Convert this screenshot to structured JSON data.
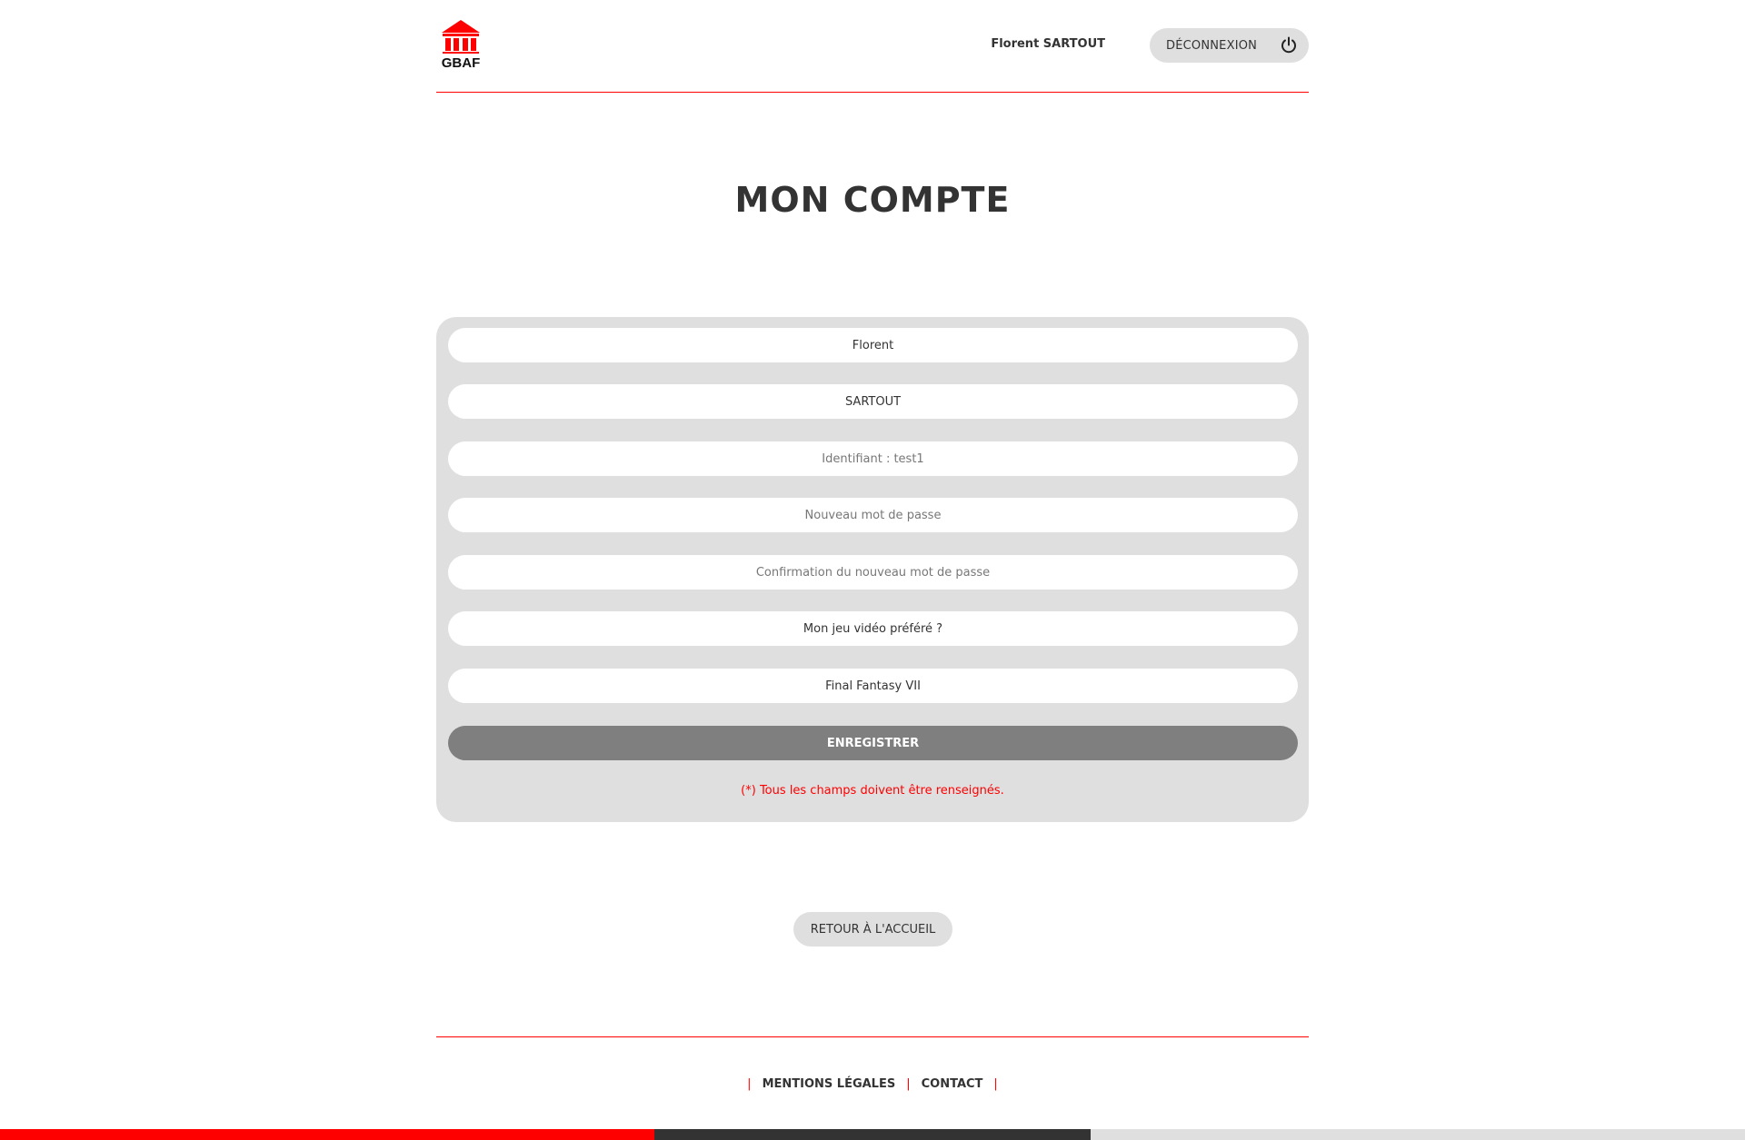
{
  "header": {
    "logo_text": "GBAF",
    "user_name": "Florent SARTOUT",
    "logout_label": "DÉCONNEXION"
  },
  "page": {
    "title": "MON COMPTE"
  },
  "form": {
    "first_name": {
      "value": "Florent"
    },
    "last_name": {
      "value": "SARTOUT"
    },
    "username": {
      "placeholder": "Identifiant : test1"
    },
    "new_password": {
      "placeholder": "Nouveau mot de passe"
    },
    "confirm_password": {
      "placeholder": "Confirmation du nouveau mot de passe"
    },
    "secret_question": {
      "value": "Mon jeu vidéo préféré ?"
    },
    "secret_answer": {
      "value": "Final Fantasy VII"
    },
    "save_label": "ENREGISTRER",
    "note": "(*) Tous les champs doivent être renseignés."
  },
  "navigation": {
    "home_label": "RETOUR À L'ACCUEIL"
  },
  "footer": {
    "separator": "|",
    "links": [
      {
        "label": "MENTIONS LÉGALES"
      },
      {
        "label": "CONTACT"
      }
    ]
  },
  "colors": {
    "accent": "#ff0000",
    "dark": "#333333",
    "light": "#dfdfdf",
    "button": "#7f7f7f"
  }
}
